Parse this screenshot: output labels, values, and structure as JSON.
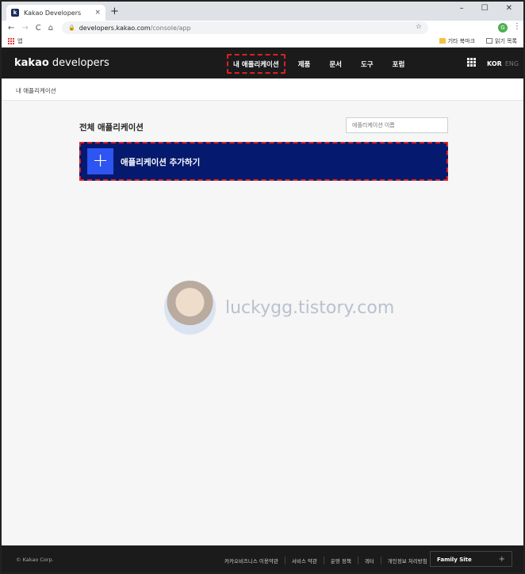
{
  "browser": {
    "tab_title": "Kakao Developers",
    "tab_favicon": "k",
    "tab_close": "×",
    "new_tab": "+",
    "window_controls": [
      "–",
      "☐",
      "✕"
    ],
    "nav_back": "←",
    "nav_forward": "→",
    "nav_reload": "C",
    "nav_home": "⌂",
    "url_host": "developers.kakao.com",
    "url_path": "/console/app",
    "profile_initial": "G",
    "bookmarks": {
      "apps_label": "앱",
      "other_bookmarks": "기타 북마크",
      "reading_list": "읽기 목록"
    }
  },
  "header": {
    "logo_bold": "kakao",
    "logo_rest": " developers",
    "nav": [
      {
        "label": "내 애플리케이션",
        "active": true
      },
      {
        "label": "제품"
      },
      {
        "label": "문서"
      },
      {
        "label": "도구"
      },
      {
        "label": "포럼"
      }
    ],
    "lang_active": "KOR",
    "lang_other": "ENG"
  },
  "breadcrumb": "내 애플리케이션",
  "main": {
    "section_title": "전체 애플리케이션",
    "search_placeholder": "애플리케이션 이름",
    "add_button_icon": "+",
    "add_button_label": "애플리케이션 추가하기"
  },
  "watermark": "luckygg.tistory.com",
  "footer": {
    "copyright": "© Kakao Corp.",
    "links": [
      "카카오비즈니스 이용약관",
      "서비스 약관",
      "운영 정책",
      "쿼터",
      "개인정보 처리방침"
    ],
    "family_site": "Family Site",
    "family_plus": "+"
  },
  "colors": {
    "header_bg": "#1b1b1b",
    "add_button_bg": "#051a6e",
    "plus_bg": "#2e54f2",
    "highlight": "#e02020",
    "content_bg": "#f5f6f5"
  }
}
